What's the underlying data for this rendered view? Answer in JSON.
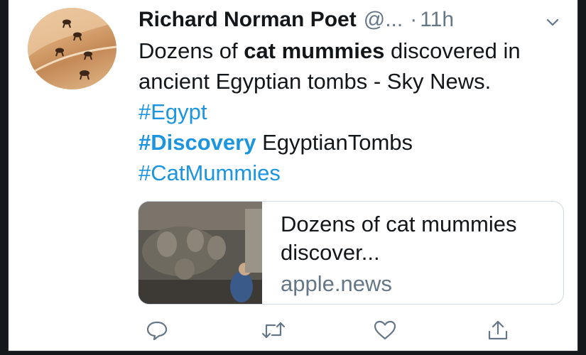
{
  "tweet": {
    "author_name": "Richard Norman Poet",
    "handle": "@...",
    "separator": "·",
    "time": "11h",
    "text": {
      "part1": "Dozens of ",
      "bold1": "cat mummies",
      "part2": " discovered in ancient Egyptian tombs - Sky News.   ",
      "tag_egypt": "#Egypt",
      "tag_discovery": "#Discovery",
      "part3": " EgyptianTombs",
      "tag_catmummies": "#CatMummies"
    },
    "card": {
      "title": "Dozens of cat mummies discover...",
      "domain": "apple.news"
    }
  },
  "icons": {
    "menu": "chevron-down-icon",
    "reply": "reply-icon",
    "retweet": "retweet-icon",
    "like": "heart-icon",
    "share": "share-icon"
  },
  "colors": {
    "link": "#1b95e0",
    "text": "#14171a",
    "muted": "#657786",
    "icon": "#657786"
  }
}
